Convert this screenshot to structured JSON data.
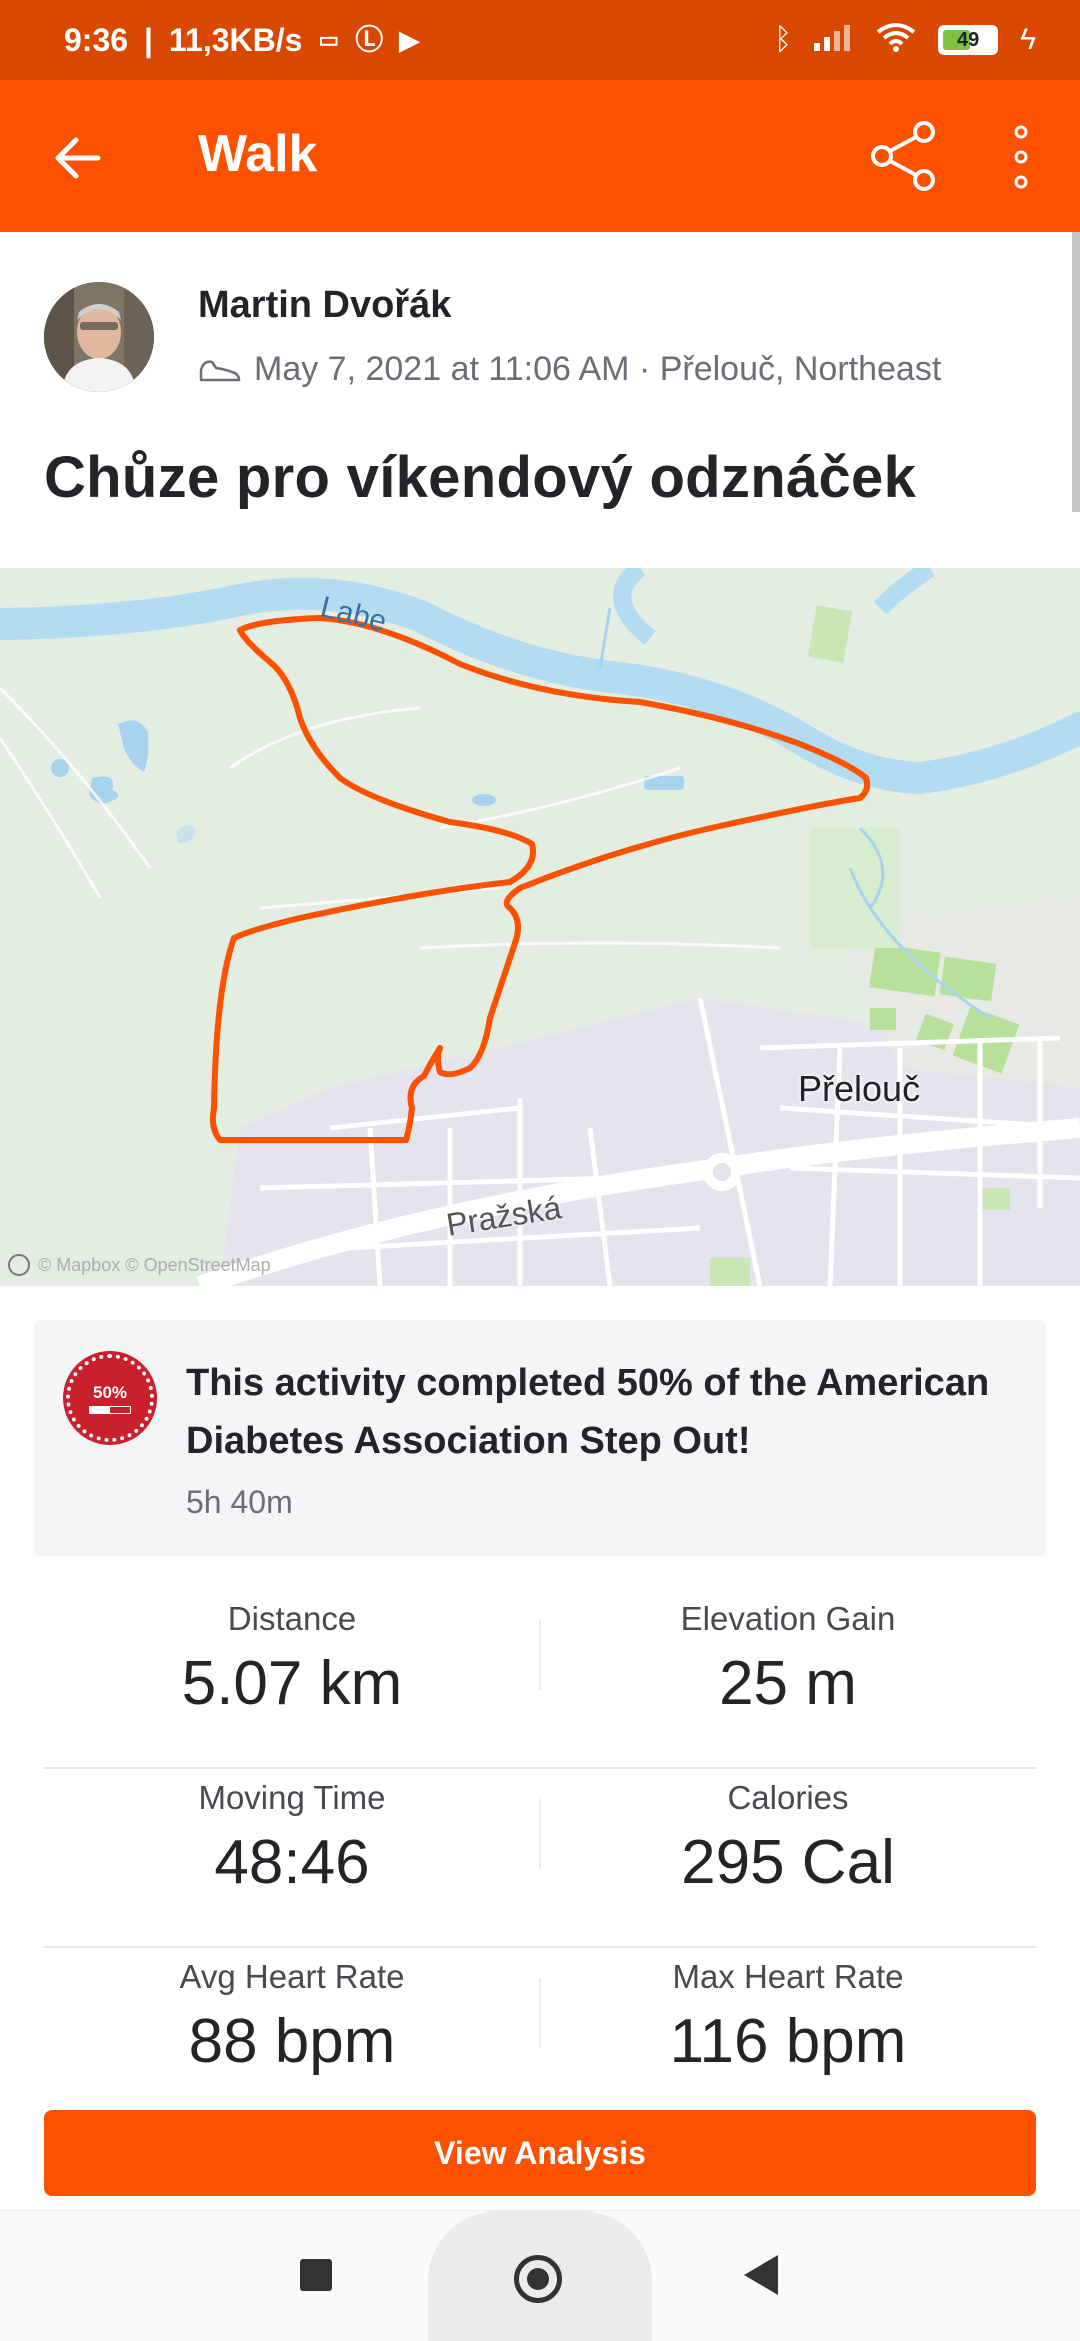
{
  "status_bar": {
    "time": "9:36",
    "speed": "11,3KB/s",
    "battery": "49"
  },
  "app_bar": {
    "title": "Walk",
    "back_icon": "back-arrow-icon",
    "share_icon": "share-icon",
    "more_icon": "more-vertical-icon"
  },
  "activity": {
    "athlete_name": "Martin Dvořák",
    "meta": "May 7, 2021 at 11:06 AM · Přelouč, Northeast",
    "title": "Chůze pro víkendový odznáček"
  },
  "map": {
    "labels": {
      "river": "Labe",
      "town": "Přelouč",
      "street": "Pražská"
    },
    "attribution": "© Mapbox © OpenStreetMap",
    "route_color": "#fc5200"
  },
  "challenge": {
    "badge_text": "50%",
    "progress": 0.5,
    "text": "This activity completed 50% of the American Diabetes Association Step Out!",
    "time": "5h 40m"
  },
  "stats": [
    {
      "left": {
        "label": "Distance",
        "value": "5.07 km"
      },
      "right": {
        "label": "Elevation Gain",
        "value": "25 m"
      }
    },
    {
      "left": {
        "label": "Moving Time",
        "value": "48:46"
      },
      "right": {
        "label": "Calories",
        "value": "295 Cal"
      }
    },
    {
      "left": {
        "label": "Avg Heart Rate",
        "value": "88 bpm"
      },
      "right": {
        "label": "Max Heart Rate",
        "value": "116 bpm"
      }
    }
  ],
  "actions": {
    "view_analysis": "View Analysis"
  },
  "colors": {
    "brand": "#fc5200",
    "status_bar": "#d84800"
  }
}
